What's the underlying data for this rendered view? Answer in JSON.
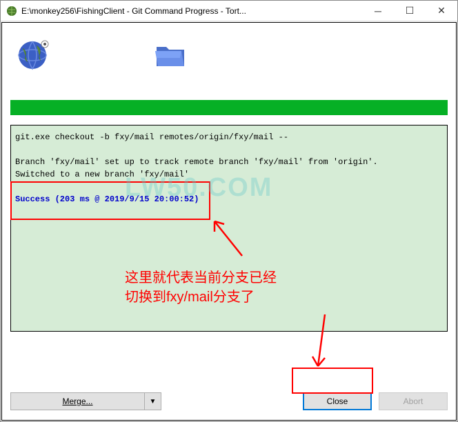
{
  "window": {
    "title": "E:\\monkey256\\FishingClient - Git Command Progress - Tort..."
  },
  "output": {
    "cmd": "git.exe checkout -b fxy/mail remotes/origin/fxy/mail --",
    "track": "Branch 'fxy/mail' set up to track remote branch 'fxy/mail' from 'origin'.",
    "switched": "Switched to a new branch 'fxy/mail'",
    "success": "Success (203 ms @ 2019/9/15 20:00:52)"
  },
  "buttons": {
    "merge": "Merge...",
    "merge_prefix": "Mer",
    "merge_underline": "g",
    "merge_suffix": "e...",
    "drop": "▼",
    "close": "Close",
    "abort": "Abort"
  },
  "annotations": {
    "text_l1": "这里就代表当前分支已经",
    "text_l2": "切换到fxy/mail分支了"
  },
  "watermark": "LW50.COM"
}
